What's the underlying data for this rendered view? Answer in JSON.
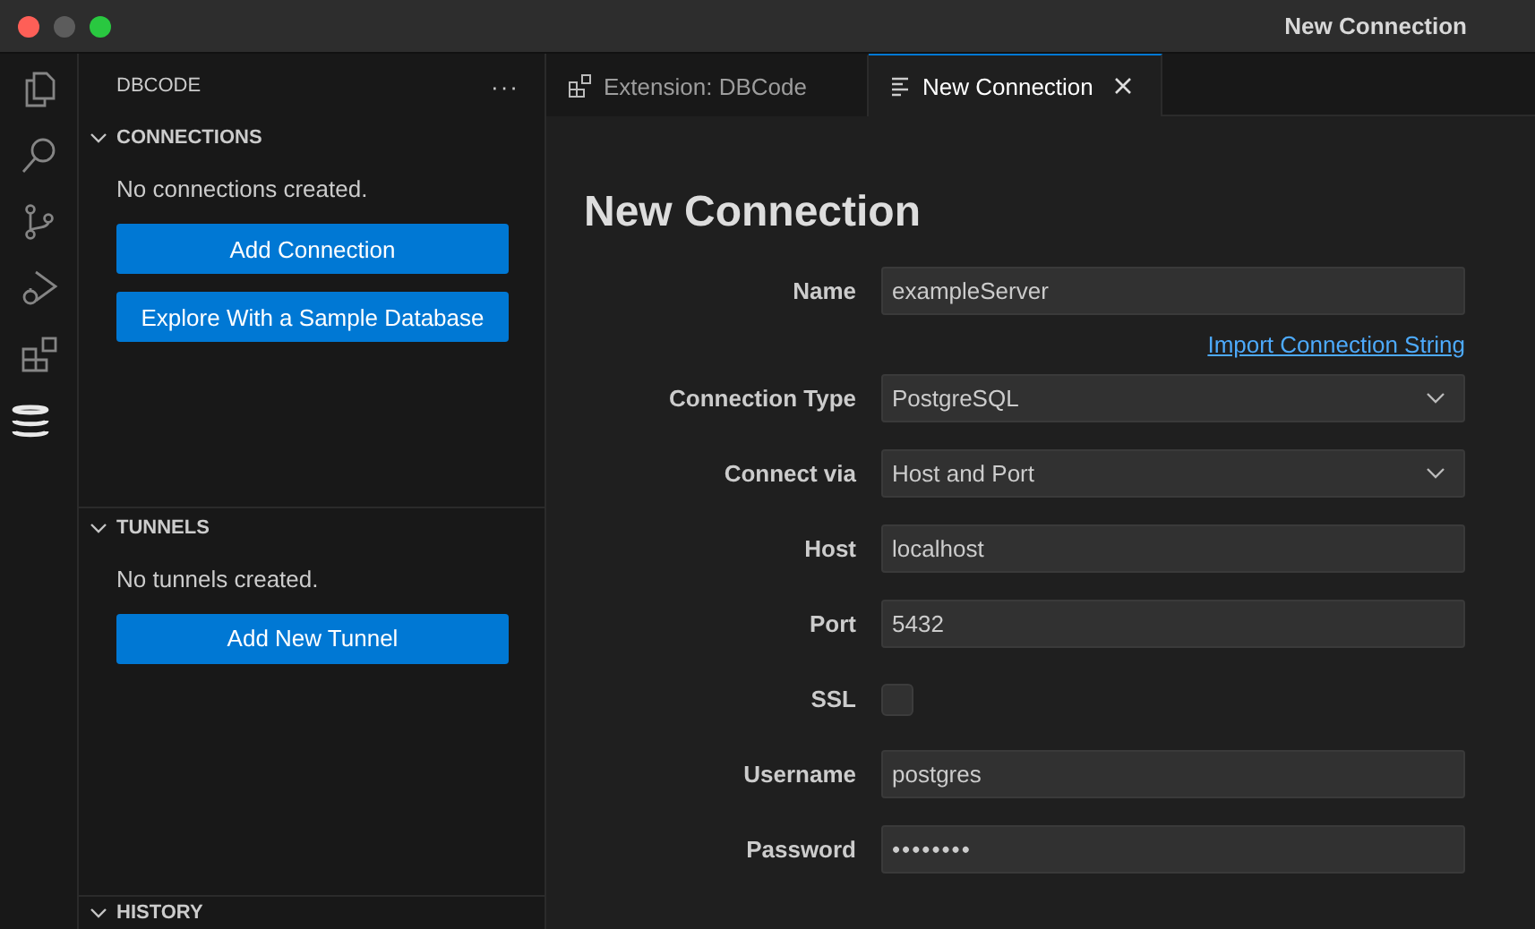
{
  "window": {
    "title": "New Connection"
  },
  "activity_bar": [
    {
      "kind": "files",
      "selected": false
    },
    {
      "kind": "search",
      "selected": false
    },
    {
      "kind": "source-control",
      "selected": false
    },
    {
      "kind": "run-debug",
      "selected": false
    },
    {
      "kind": "extensions",
      "selected": false
    },
    {
      "kind": "database",
      "selected": true
    }
  ],
  "sidebar": {
    "title": "DBCODE",
    "more": "···",
    "sections": [
      {
        "title": "CONNECTIONS",
        "expanded": true,
        "message": "No connections created.",
        "buttons": [
          "Add Connection",
          "Explore With a Sample Database"
        ]
      },
      {
        "title": "TUNNELS",
        "expanded": true,
        "message": "No tunnels created.",
        "buttons": [
          "Add New Tunnel"
        ]
      },
      {
        "title": "HISTORY",
        "expanded": true
      }
    ]
  },
  "tabs": [
    {
      "label": "Extension: DBCode",
      "kind": "extension",
      "selected": false
    },
    {
      "label": "New Connection",
      "kind": "form",
      "selected": true
    }
  ],
  "form": {
    "heading": "New Connection",
    "rows": [
      {
        "kind": "text",
        "label": "Name",
        "value": "exampleServer"
      },
      {
        "kind": "link",
        "text": "Import Connection String"
      },
      {
        "kind": "select",
        "label": "Connection Type",
        "value": "PostgreSQL"
      },
      {
        "kind": "select",
        "label": "Connect via",
        "value": "Host and Port"
      },
      {
        "kind": "text",
        "label": "Host",
        "value": "localhost"
      },
      {
        "kind": "text",
        "label": "Port",
        "value": "5432"
      },
      {
        "kind": "checkbox",
        "label": "SSL",
        "checked": false
      },
      {
        "kind": "text",
        "label": "Username",
        "value": "postgres"
      },
      {
        "kind": "password",
        "label": "Password",
        "value": "••••••••"
      }
    ]
  }
}
